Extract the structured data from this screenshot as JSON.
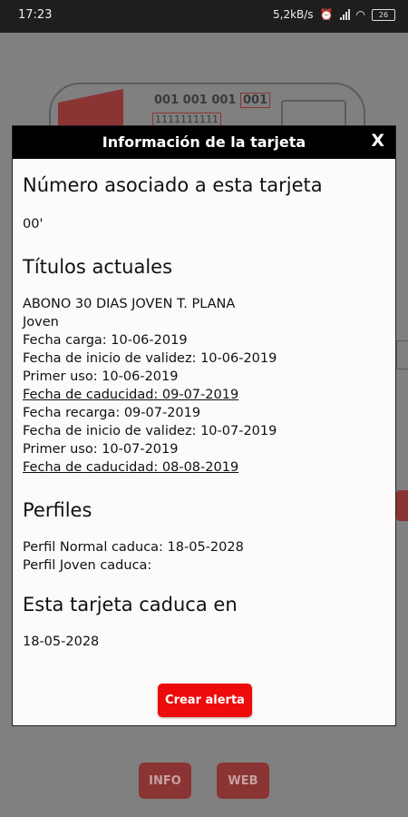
{
  "status_bar": {
    "time": "17:23",
    "speed": "5,2kB/s",
    "battery": "26"
  },
  "background": {
    "card_number": "001 001 001",
    "card_number_tail": "001",
    "card_binary": "1111111111",
    "info_button": "INFO",
    "web_button": "WEB"
  },
  "dialog": {
    "title": "Información de la tarjeta",
    "close_label": "X",
    "section_number": {
      "heading": "Número asociado a esta tarjeta",
      "value": "00'"
    },
    "section_titles": {
      "heading": "Títulos actuales",
      "lines": [
        "ABONO 30 DIAS JOVEN T. PLANA",
        "Joven",
        "Fecha carga: 10-06-2019",
        "Fecha de inicio de validez: 10-06-2019",
        "Primer uso: 10-06-2019",
        "Fecha de caducidad: 09-07-2019",
        "Fecha recarga: 09-07-2019",
        "Fecha de inicio de validez: 10-07-2019",
        "Primer uso: 10-07-2019",
        "Fecha de caducidad: 08-08-2019"
      ]
    },
    "section_profiles": {
      "heading": "Perfiles",
      "lines": [
        "Perfil Normal caduca: 18-05-2028",
        "Perfil Joven caduca:"
      ]
    },
    "section_expiry": {
      "heading": "Esta tarjeta caduca en",
      "value": "18-05-2028"
    },
    "alert_button": "Crear alerta"
  },
  "colors": {
    "alert_button": "#ee0b0b",
    "header": "#000000",
    "dim_accent": "#8a3434"
  }
}
